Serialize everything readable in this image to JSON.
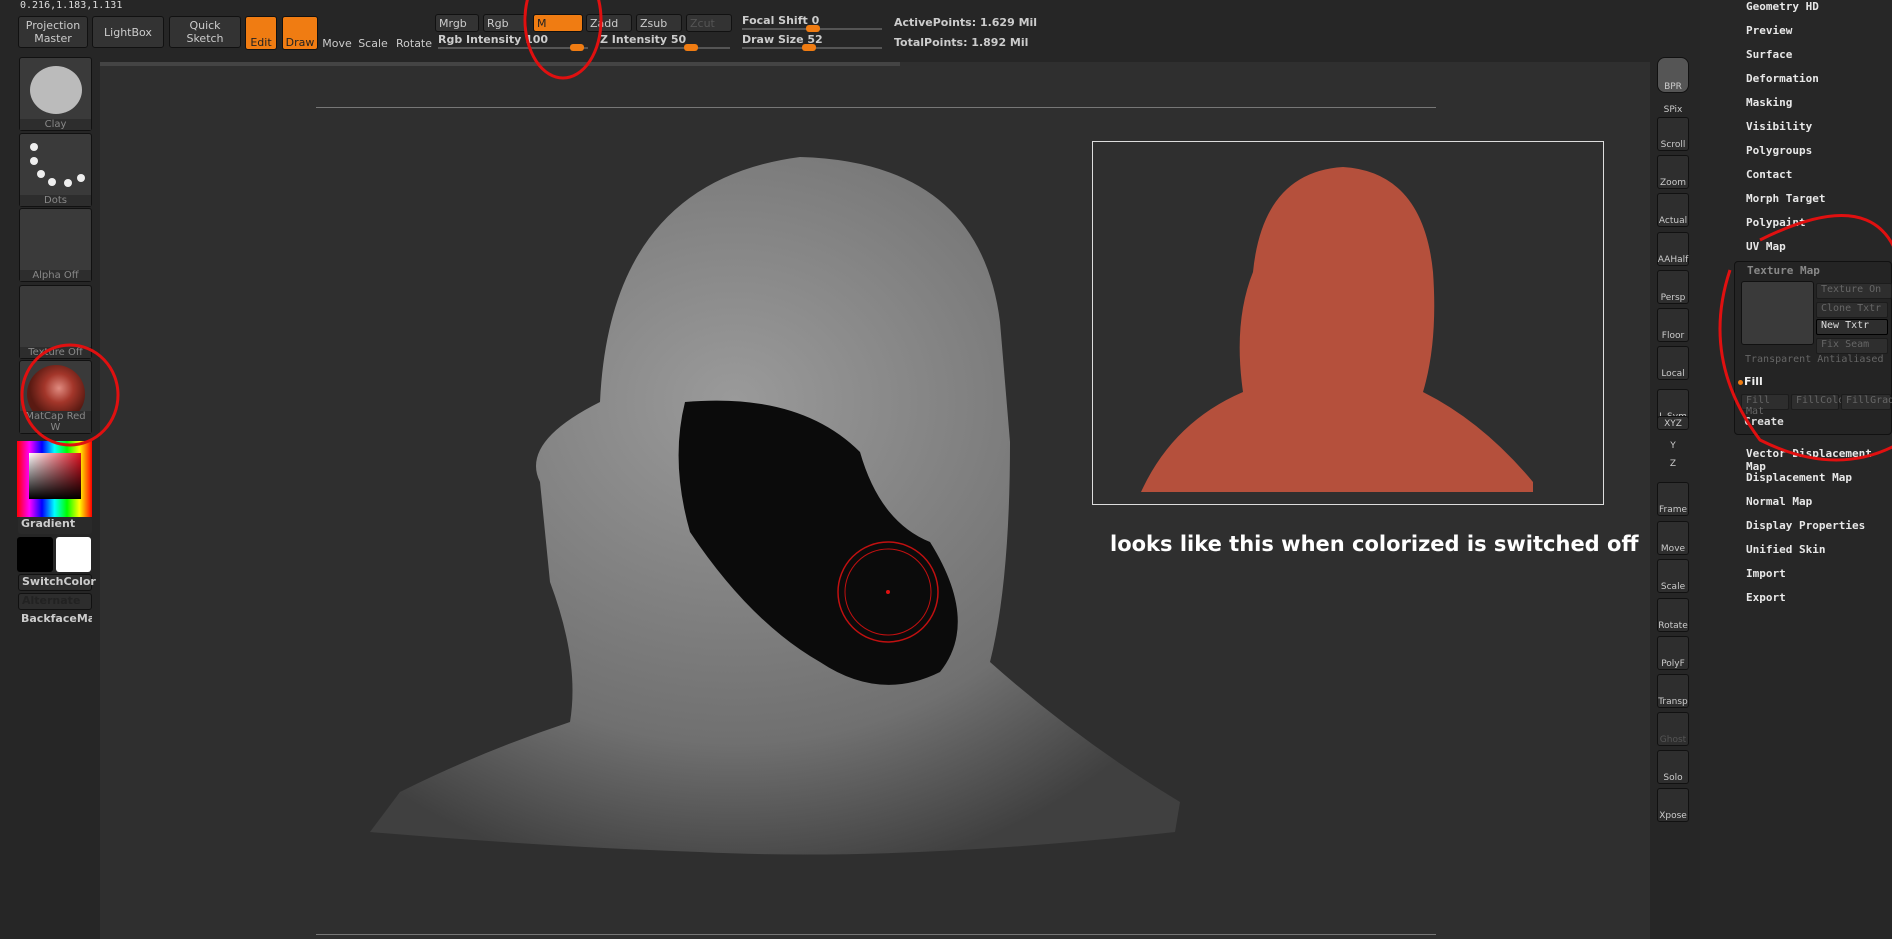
{
  "coords": "0.216,1.183,1.131",
  "toolbar": {
    "projection_master": "Projection Master",
    "lightbox": "LightBox",
    "quick_sketch": "Quick Sketch",
    "edit": "Edit",
    "draw": "Draw",
    "move": "Move",
    "scale": "Scale",
    "rotate": "Rotate",
    "mrgb": "Mrgb",
    "rgb": "Rgb",
    "m": "M",
    "zadd": "Zadd",
    "zsub": "Zsub",
    "zcut": "Zcut",
    "rgb_intensity": "Rgb Intensity 100",
    "z_intensity": "Z Intensity 50",
    "focal_shift": "Focal Shift 0",
    "draw_size": "Draw Size 52",
    "active_points": "ActivePoints: 1.629 Mil",
    "total_points": "TotalPoints: 1.892 Mil",
    "rgb_intensity_value": 100,
    "z_intensity_value": 50,
    "focal_shift_value": 0,
    "draw_size_value": 52
  },
  "left": {
    "brush": "Clay",
    "stroke": "Dots",
    "alpha": "Alpha Off",
    "texture": "Texture Off",
    "material": "MatCap Red W",
    "gradient": "Gradient",
    "switch_color": "SwitchColor",
    "alternate": "Alternate",
    "backface": "BackfaceMa:"
  },
  "right_tools": [
    "BPR",
    "SPix",
    "Scroll",
    "Zoom",
    "Actual",
    "AAHalf",
    "Persp",
    "Floor",
    "Local",
    "L.Sym",
    "XYZ",
    "Y",
    "Z",
    "Frame",
    "Move",
    "Scale",
    "Rotate",
    "PolyF",
    "Transp",
    "Ghost",
    "Solo",
    "Xpose"
  ],
  "menu_top": [
    "Geometry HD",
    "Preview",
    "Surface",
    "Deformation",
    "Masking",
    "Visibility",
    "Polygroups",
    "Contact",
    "Morph Target",
    "Polypaint",
    "UV Map"
  ],
  "texture_map": {
    "title": "Texture Map",
    "texture_on": "Texture On",
    "clone": "Clone Txtr",
    "new": "New Txtr",
    "fix_seam": "Fix Seam",
    "transparent": "Transparent Antialiased",
    "fill": "Fill",
    "fill_mat": "Fill Mat",
    "fill_color": "FillColor",
    "fill_grad": "FillGrad",
    "create": "Create"
  },
  "menu_bottom": [
    "Vector Displacement Map",
    "Displacement Map",
    "Normal Map",
    "Display Properties",
    "Unified Skin",
    "Import",
    "Export"
  ],
  "annotation": "looks like this when colorized is switched off",
  "colors": {
    "accent": "#f07c12",
    "annotation_red": "#e01010"
  }
}
